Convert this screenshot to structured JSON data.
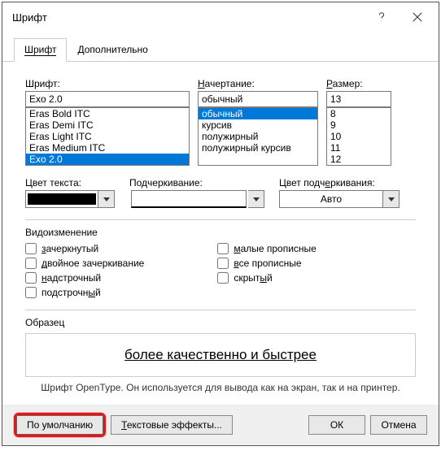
{
  "title": "Шрифт",
  "tabs": {
    "font": "Шрифт",
    "advanced": "Дополнительно"
  },
  "labels": {
    "font": "Шрифт:",
    "style": "Начертание:",
    "size": "Размер:",
    "fontcolor": "Цвет текста:",
    "underline": "Подчеркивание:",
    "underlinecolor": "Цвет подчеркивания:",
    "underlinecolor_pre": "Цвет подч",
    "underlinecolor_acc": "е",
    "underlinecolor_post": "ркивания:",
    "effects": "Видоизменение",
    "preview": "Образец"
  },
  "font": {
    "value": "Exo 2.0",
    "list": [
      "Eras Bold ITC",
      "Eras Demi ITC",
      "Eras Light ITC",
      "Eras Medium ITC",
      "Exo 2.0"
    ]
  },
  "style": {
    "value": "обычный",
    "list": [
      "обычный",
      "курсив",
      "полужирный",
      "полужирный курсив"
    ]
  },
  "size": {
    "value": "13",
    "list": [
      "8",
      "9",
      "10",
      "11",
      "12"
    ]
  },
  "underline_combo": "Авто",
  "checks": {
    "left": [
      {
        "acc": "з",
        "rest": "ачеркнутый"
      },
      {
        "acc": "д",
        "rest": "войное зачеркивание"
      },
      {
        "acc": "н",
        "rest": "адстрочный"
      },
      {
        "acc": "п",
        "rest": "одстрочный",
        "pre": "",
        "accpos": 0
      }
    ],
    "right": [
      {
        "acc": "м",
        "rest": "алые прописные"
      },
      {
        "acc": "в",
        "rest": "се прописные"
      },
      {
        "acc": "с",
        "rest": "крытый"
      }
    ],
    "l0": "зачеркнутый",
    "l1": "двойное зачеркивание",
    "l2": "надстрочный",
    "l3_pre": "подстрочн",
    "l3_acc": "ы",
    "l3_post": "й",
    "r0": "малые прописные",
    "r1": "все прописные",
    "r2": "скрытый"
  },
  "preview_text": "более качественно и быстрее",
  "note": "Шрифт OpenType. Он используется для вывода как на экран, так и на принтер.",
  "buttons": {
    "default": "По умолчанию",
    "texteffects": "Текстовые эффекты...",
    "ok": "ОК",
    "cancel": "Отмена"
  }
}
